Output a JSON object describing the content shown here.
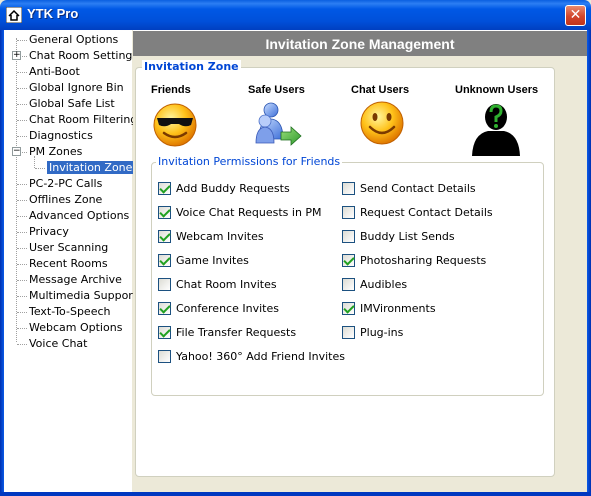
{
  "window": {
    "title": "YTK Pro",
    "close_glyph": "✕"
  },
  "tree": {
    "items": [
      {
        "label": "General Options",
        "name": "tree-item-general-options",
        "level": 0,
        "expander": ""
      },
      {
        "label": "Chat Room Settings",
        "name": "tree-item-chat-room-settings",
        "level": 0,
        "expander": "+"
      },
      {
        "label": "Anti-Boot",
        "name": "tree-item-anti-boot",
        "level": 0,
        "expander": ""
      },
      {
        "label": "Global Ignore Bin",
        "name": "tree-item-global-ignore-bin",
        "level": 0,
        "expander": ""
      },
      {
        "label": "Global Safe List",
        "name": "tree-item-global-safe-list",
        "level": 0,
        "expander": ""
      },
      {
        "label": "Chat Room Filtering",
        "name": "tree-item-chat-room-filtering",
        "level": 0,
        "expander": ""
      },
      {
        "label": "Diagnostics",
        "name": "tree-item-diagnostics",
        "level": 0,
        "expander": ""
      },
      {
        "label": "PM Zones",
        "name": "tree-item-pm-zones",
        "level": 0,
        "expander": "−"
      },
      {
        "label": "Invitation Zones",
        "name": "tree-item-invitation-zones",
        "level": 1,
        "expander": "",
        "selected": true
      },
      {
        "label": "PC-2-PC Calls",
        "name": "tree-item-pc-2-pc-calls",
        "level": 0,
        "expander": ""
      },
      {
        "label": "Offlines Zone",
        "name": "tree-item-offlines-zone",
        "level": 0,
        "expander": ""
      },
      {
        "label": "Advanced Options",
        "name": "tree-item-advanced-options",
        "level": 0,
        "expander": ""
      },
      {
        "label": "Privacy",
        "name": "tree-item-privacy",
        "level": 0,
        "expander": ""
      },
      {
        "label": "User Scanning",
        "name": "tree-item-user-scanning",
        "level": 0,
        "expander": ""
      },
      {
        "label": "Recent Rooms",
        "name": "tree-item-recent-rooms",
        "level": 0,
        "expander": ""
      },
      {
        "label": "Message Archive",
        "name": "tree-item-message-archive",
        "level": 0,
        "expander": ""
      },
      {
        "label": "Multimedia Support",
        "name": "tree-item-multimedia-support",
        "level": 0,
        "expander": ""
      },
      {
        "label": "Text-To-Speech",
        "name": "tree-item-text-to-speech",
        "level": 0,
        "expander": ""
      },
      {
        "label": "Webcam Options",
        "name": "tree-item-webcam-options",
        "level": 0,
        "expander": ""
      },
      {
        "label": "Voice Chat",
        "name": "tree-item-voice-chat",
        "level": 0,
        "expander": ""
      }
    ]
  },
  "header": {
    "title": "Invitation Zone Management"
  },
  "zone": {
    "legend": "Invitation Zone",
    "categories": [
      {
        "label": "Friends",
        "icon": "cool-smiley-icon"
      },
      {
        "label": "Safe Users",
        "icon": "safe-users-icon"
      },
      {
        "label": "Chat Users",
        "icon": "smiley-icon"
      },
      {
        "label": "Unknown Users",
        "icon": "unknown-user-icon"
      }
    ]
  },
  "permissions": {
    "legend": "Invitation Permissions for Friends",
    "left": [
      {
        "label": "Add Buddy Requests",
        "checked": true,
        "name": "add-buddy-requests-checkbox"
      },
      {
        "label": "Voice Chat Requests in PM",
        "checked": true,
        "name": "voice-chat-requests-checkbox"
      },
      {
        "label": "Webcam Invites",
        "checked": true,
        "name": "webcam-invites-checkbox"
      },
      {
        "label": "Game Invites",
        "checked": true,
        "name": "game-invites-checkbox"
      },
      {
        "label": "Chat Room Invites",
        "checked": false,
        "name": "chat-room-invites-checkbox"
      },
      {
        "label": "Conference Invites",
        "checked": true,
        "name": "conference-invites-checkbox"
      },
      {
        "label": "File Transfer Requests",
        "checked": true,
        "name": "file-transfer-requests-checkbox"
      },
      {
        "label": "Yahoo! 360° Add Friend Invites",
        "checked": false,
        "name": "yahoo-360-invites-checkbox"
      }
    ],
    "right": [
      {
        "label": "Send Contact Details",
        "checked": false,
        "name": "send-contact-details-checkbox"
      },
      {
        "label": "Request Contact Details",
        "checked": false,
        "name": "request-contact-details-checkbox"
      },
      {
        "label": "Buddy List Sends",
        "checked": false,
        "name": "buddy-list-sends-checkbox"
      },
      {
        "label": "Photosharing Requests",
        "checked": true,
        "name": "photosharing-requests-checkbox"
      },
      {
        "label": "Audibles",
        "checked": false,
        "name": "audibles-checkbox"
      },
      {
        "label": "IMVironments",
        "checked": true,
        "name": "imvironments-checkbox"
      },
      {
        "label": "Plug-ins",
        "checked": false,
        "name": "plug-ins-checkbox"
      }
    ]
  },
  "colors": {
    "titlebar": "#0058E6",
    "header_bar": "#808080",
    "legend_text": "#0046D5",
    "selection": "#316AC5",
    "check": "#21A121"
  }
}
